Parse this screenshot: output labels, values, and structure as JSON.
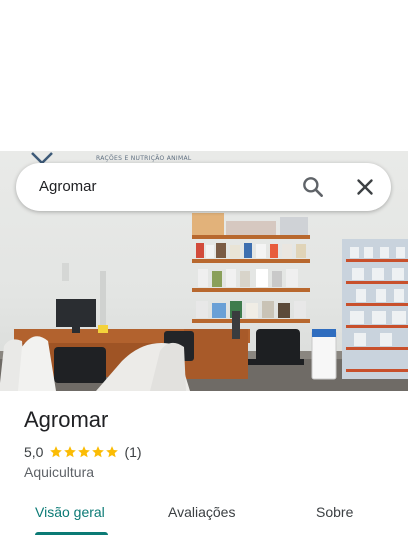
{
  "hero": {
    "sign_text": "RAÇÕES E NUTRIÇÃO ANIMAL"
  },
  "search": {
    "value": "Agromar",
    "search_icon": "search-icon",
    "close_icon": "close-icon"
  },
  "place": {
    "name": "Agromar",
    "rating": "5,0",
    "stars": 5,
    "review_count": "(1)",
    "category": "Aquicultura"
  },
  "tabs": [
    {
      "label": "Visão geral",
      "active": true
    },
    {
      "label": "Avaliações",
      "active": false
    },
    {
      "label": "Sobre",
      "active": false
    }
  ],
  "colors": {
    "accent": "#0b7a75",
    "star": "#fbbc04"
  }
}
